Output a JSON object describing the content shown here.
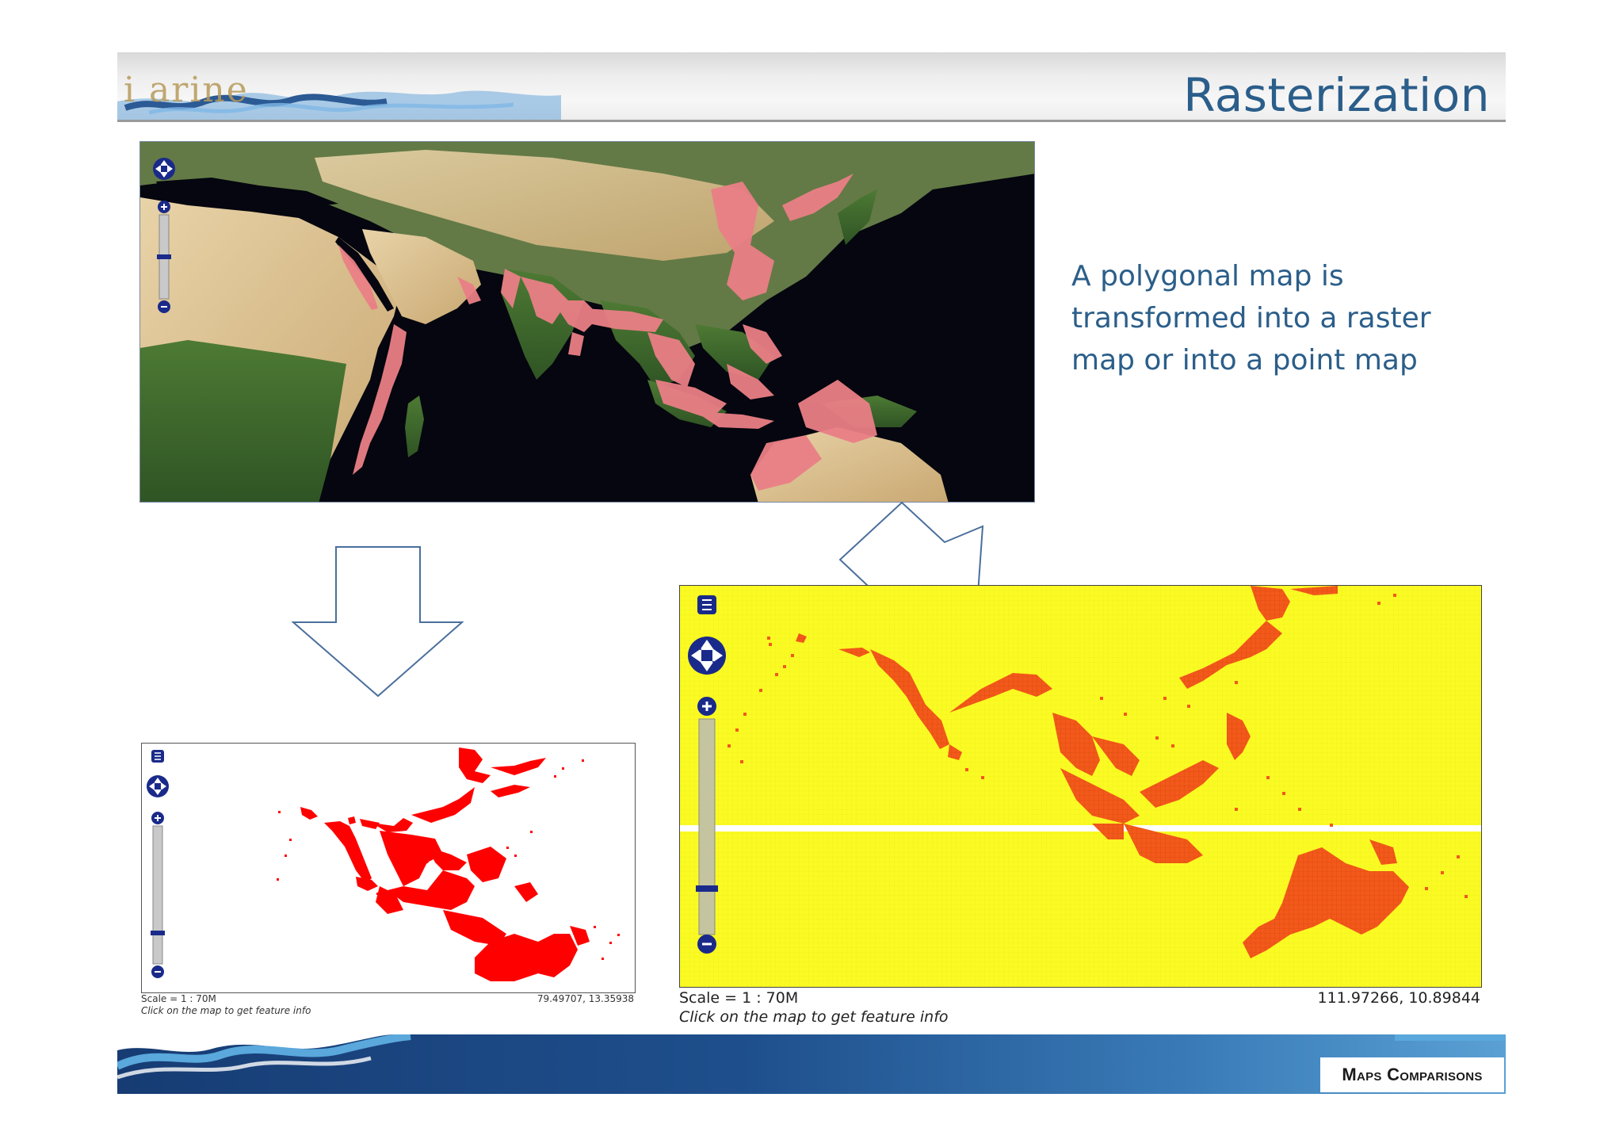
{
  "slide": {
    "title": "Rasterization",
    "logo_text": "i  arine",
    "description": "A polygonal map is transformed into a raster map or into a point map",
    "footer_label": "Maps Comparisons"
  },
  "map_small": {
    "scale": "Scale = 1 : 70M",
    "hint": "Click on the map to get feature info",
    "coords": "79.49707, 13.35938"
  },
  "map_big": {
    "scale": "Scale = 1 : 70M",
    "hint": "Click on the map to get feature info",
    "coords": "111.97266, 10.89844"
  },
  "colors": {
    "title": "#2b5e8a",
    "raster_red": "#ff0000",
    "point_orange": "#f2591a",
    "point_bg": "#fbfb23",
    "polygon_pink": "#ea7f86"
  }
}
